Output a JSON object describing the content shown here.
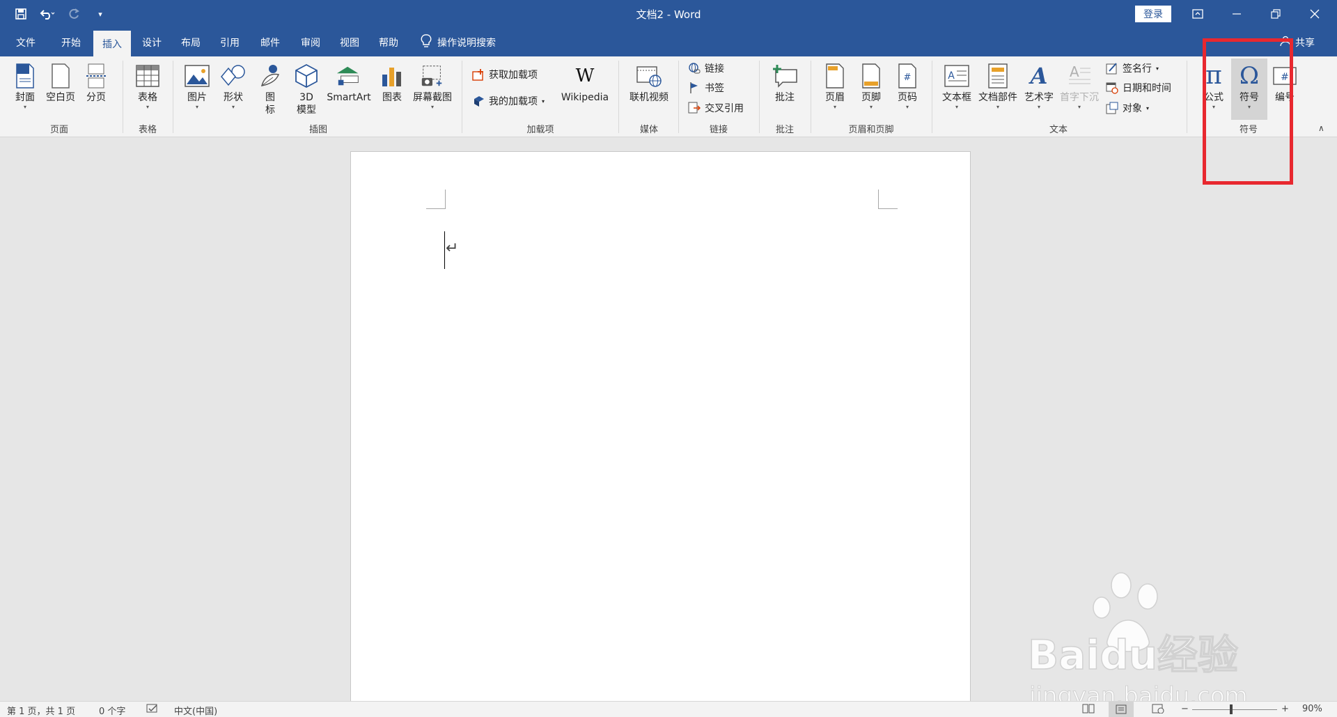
{
  "window": {
    "title": "文档2  -  Word",
    "login": "登录"
  },
  "qat": {
    "save_icon": "save-icon",
    "undo_icon": "undo-icon",
    "redo_icon": "redo-icon",
    "customize_icon": "customize-qat-icon"
  },
  "tabs": [
    "文件",
    "开始",
    "插入",
    "设计",
    "布局",
    "引用",
    "邮件",
    "审阅",
    "视图",
    "帮助"
  ],
  "active_tab": "插入",
  "tell_me": "操作说明搜索",
  "share": "共享",
  "ribbon": {
    "pages": {
      "cover": "封面",
      "blank": "空白页",
      "break": "分页",
      "group": "页面"
    },
    "tables": {
      "table": "表格",
      "group": "表格"
    },
    "illustrations": {
      "picture": "图片",
      "shapes": "形状",
      "icons": "图\n标",
      "model3d": "3D\n模型",
      "smartart": "SmartArt",
      "chart": "图表",
      "screenshot": "屏幕截图",
      "group": "插图"
    },
    "addins": {
      "get": "获取加载项",
      "my": "我的加载项",
      "wikipedia": "Wikipedia",
      "group": "加载项"
    },
    "media": {
      "video": "联机视频",
      "group": "媒体"
    },
    "links": {
      "link": "链接",
      "bookmark": "书签",
      "crossref": "交叉引用",
      "group": "链接"
    },
    "comments": {
      "comment": "批注",
      "group": "批注"
    },
    "header_footer": {
      "header": "页眉",
      "footer": "页脚",
      "pagenum": "页码",
      "group": "页眉和页脚"
    },
    "text": {
      "textbox": "文本框",
      "quickparts": "文档部件",
      "wordart": "艺术字",
      "dropcap": "首字下沉",
      "signature": "签名行",
      "datetime": "日期和时间",
      "object": "对象",
      "group": "文本"
    },
    "symbols": {
      "equation": "公式",
      "symbol": "符号",
      "number": "编号",
      "group": "符号"
    }
  },
  "status": {
    "page": "第 1 页，共 1 页",
    "words": "0 个字",
    "lang": "中文(中国)",
    "zoom": "90%"
  },
  "watermark": {
    "brand": "Baidu经验",
    "url": "jingyan.baidu.com"
  },
  "colors": {
    "accent": "#2b579a",
    "highlight": "#e8282f"
  }
}
